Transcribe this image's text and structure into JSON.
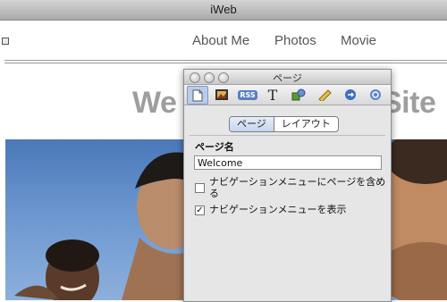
{
  "window": {
    "title": "iWeb"
  },
  "nav": {
    "items": [
      "About Me",
      "Photos",
      "Movie"
    ]
  },
  "site_title": {
    "left": "We",
    "right": "Site"
  },
  "inspector": {
    "title": "ページ",
    "toolbar_icons": [
      "page-icon",
      "photo-icon",
      "rss-icon",
      "text-icon",
      "graphic-icon",
      "metrics-icon",
      "link-icon",
      "qt-icon"
    ],
    "rss_label": "RSS",
    "text_tool_label": "T",
    "tabs": {
      "page": "ページ",
      "layout": "レイアウト"
    },
    "page_name_label": "ページ名",
    "page_name_value": "Welcome",
    "checkbox_nav_include": {
      "label": "ナビゲーションメニューにページを含める",
      "checked": false
    },
    "checkbox_nav_show": {
      "label": "ナビゲーションメニューを表示",
      "checked": true
    }
  }
}
